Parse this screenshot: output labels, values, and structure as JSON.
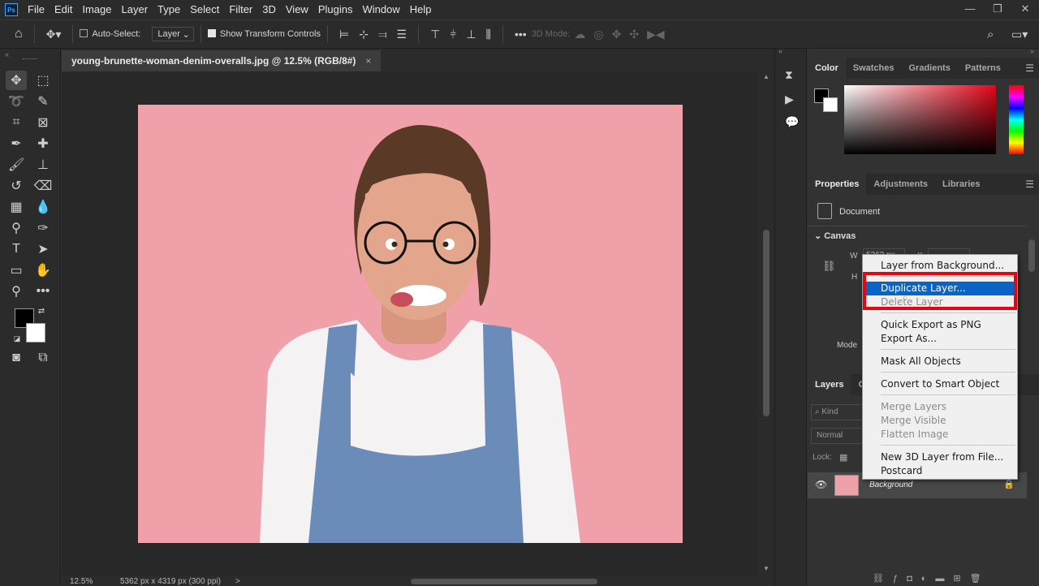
{
  "app": {
    "logo": "Ps"
  },
  "menubar": {
    "items": [
      "File",
      "Edit",
      "Image",
      "Layer",
      "Type",
      "Select",
      "Filter",
      "3D",
      "View",
      "Plugins",
      "Window",
      "Help"
    ]
  },
  "window_controls": {
    "minimize": "—",
    "restore": "❐",
    "close": "✕"
  },
  "options_bar": {
    "auto_select_label": "Auto-Select:",
    "auto_select_checked": false,
    "target_value": "Layer",
    "show_transform_label": "Show Transform Controls",
    "show_transform_checked": true,
    "mode_3d_label": "3D Mode:"
  },
  "document": {
    "tab_title": "young-brunette-woman-denim-overalls.jpg @ 12.5% (RGB/8#)",
    "close": "×",
    "background_color": "#efa0a8"
  },
  "status": {
    "zoom": "12.5%",
    "size": "5362 px x 4319 px (300 ppi)",
    "arrow": ">"
  },
  "color_panel": {
    "tabs": [
      "Color",
      "Swatches",
      "Gradients",
      "Patterns"
    ],
    "active_tab": "Color",
    "foreground": "#000000",
    "background": "#ffffff"
  },
  "properties_panel": {
    "tabs": [
      "Properties",
      "Adjustments",
      "Libraries"
    ],
    "active_tab": "Properties",
    "doc_label": "Document",
    "canvas_section": "Canvas",
    "w_label": "W",
    "w_value": "5362 px",
    "h_label": "H",
    "mode_label": "Mode"
  },
  "layers_panel": {
    "tabs": [
      "Layers",
      "Ch"
    ],
    "active_tab": "Layers",
    "search_placeholder": "Kind",
    "blend_mode": "Normal",
    "lock_label": "Lock:",
    "layer_name": "Background"
  },
  "context_menu": {
    "items": [
      {
        "label": "Layer from Background...",
        "disabled": false
      },
      {
        "label": "Duplicate Layer...",
        "disabled": false,
        "highlighted": true
      },
      {
        "label": "Delete Layer",
        "disabled": true
      },
      {
        "label": "Quick Export as PNG",
        "disabled": false
      },
      {
        "label": "Export As...",
        "disabled": false
      },
      {
        "label": "Mask All Objects",
        "disabled": false
      },
      {
        "label": "Convert to Smart Object",
        "disabled": false
      },
      {
        "label": "Merge Layers",
        "disabled": true
      },
      {
        "label": "Merge Visible",
        "disabled": true
      },
      {
        "label": "Flatten Image",
        "disabled": true
      },
      {
        "label": "New 3D Layer from File...",
        "disabled": false
      },
      {
        "label": "Postcard",
        "disabled": false
      }
    ],
    "highlight_color": "#0a64c8",
    "annotation_color": "#e30613"
  }
}
